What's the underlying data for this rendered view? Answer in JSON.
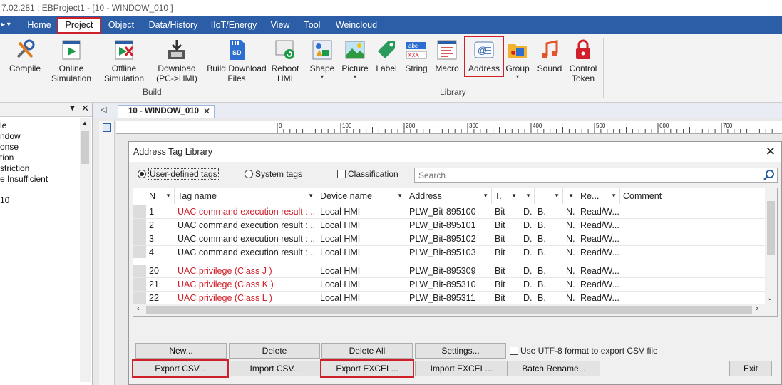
{
  "window_title": "7.02.281 : EBProject1 - [10 - WINDOW_010 ]",
  "quick_access_glyph": "▸ ▾",
  "menu": {
    "items": [
      "Home",
      "Project",
      "Object",
      "Data/History",
      "IIoT/Energy",
      "View",
      "Tool",
      "Weincloud"
    ],
    "active": "Project"
  },
  "ribbon": {
    "build_buttons": [
      {
        "label1": "Compile",
        "label2": "",
        "icon": "compile-icon"
      },
      {
        "label1": "Online",
        "label2": "Simulation",
        "icon": "online-simulation-icon"
      },
      {
        "label1": "Offline",
        "label2": "Simulation",
        "icon": "offline-simulation-icon"
      },
      {
        "label1": "Download",
        "label2": "(PC->HMI)",
        "icon": "download-icon"
      },
      {
        "label1": "Build Download",
        "label2": "Files",
        "icon": "sd-card-icon"
      },
      {
        "label1": "Reboot",
        "label2": "HMI",
        "icon": "reboot-icon"
      }
    ],
    "build_group_label": "Build",
    "library_buttons": [
      {
        "label1": "Shape",
        "label2": "▾",
        "icon": "shape-icon"
      },
      {
        "label1": "Picture",
        "label2": "▾",
        "icon": "picture-icon"
      },
      {
        "label1": "Label",
        "label2": "",
        "icon": "label-icon"
      },
      {
        "label1": "String",
        "label2": "",
        "icon": "string-icon"
      },
      {
        "label1": "Macro",
        "label2": "",
        "icon": "macro-icon"
      },
      {
        "label1": "Address",
        "label2": "",
        "icon": "address-icon"
      },
      {
        "label1": "Group",
        "label2": "▾",
        "icon": "group-icon"
      },
      {
        "label1": "Sound",
        "label2": "",
        "icon": "sound-icon"
      },
      {
        "label1": "Control",
        "label2": "Token",
        "icon": "lock-icon"
      }
    ],
    "library_group_label": "Library"
  },
  "left_tree": {
    "items": [
      "le",
      "ndow",
      "onse",
      "tion",
      "striction",
      "e Insufficient",
      "10"
    ]
  },
  "tab": {
    "label": "10 - WINDOW_010"
  },
  "ruler_labels": [
    "0",
    "100",
    "200",
    "300",
    "400",
    "500",
    "600",
    "700"
  ],
  "dialog": {
    "title": "Address Tag Library",
    "radio_user": "User-defined tags",
    "radio_system": "System tags",
    "classification": "Classification",
    "search_placeholder": "Search",
    "columns": [
      "N",
      "Tag name",
      "Device name",
      "Address",
      "T.",
      "",
      "",
      "",
      "Re...",
      "Comment"
    ],
    "rows": [
      {
        "n": "1",
        "tag": "UAC command execution result : ...",
        "device": "Local HMI",
        "address": "PLW_Bit-895100",
        "t": "Bit",
        "c6": "D.",
        "c7": "B.",
        "c8": "N.",
        "re": "Read/W...",
        "red": true
      },
      {
        "n": "2",
        "tag": "UAC command execution result : ...",
        "device": "Local HMI",
        "address": "PLW_Bit-895101",
        "t": "Bit",
        "c6": "D.",
        "c7": "B.",
        "c8": "N.",
        "re": "Read/W...",
        "red": false
      },
      {
        "n": "3",
        "tag": "UAC command execution result : ...",
        "device": "Local HMI",
        "address": "PLW_Bit-895102",
        "t": "Bit",
        "c6": "D.",
        "c7": "B.",
        "c8": "N.",
        "re": "Read/W...",
        "red": false
      },
      {
        "n": "4",
        "tag": "UAC command execution result : ...",
        "device": "Local HMI",
        "address": "PLW_Bit-895103",
        "t": "Bit",
        "c6": "D.",
        "c7": "B.",
        "c8": "N.",
        "re": "Read/W...",
        "red": false
      },
      {
        "n": "20",
        "tag": "UAC privilege (Class J )",
        "device": "Local HMI",
        "address": "PLW_Bit-895309",
        "t": "Bit",
        "c6": "D.",
        "c7": "B.",
        "c8": "N.",
        "re": "Read/W...",
        "red": true
      },
      {
        "n": "21",
        "tag": "UAC privilege (Class K )",
        "device": "Local HMI",
        "address": "PLW_Bit-895310",
        "t": "Bit",
        "c6": "D.",
        "c7": "B.",
        "c8": "N.",
        "re": "Read/W...",
        "red": true
      },
      {
        "n": "22",
        "tag": "UAC privilege (Class L )",
        "device": "Local HMI",
        "address": "PLW_Bit-895311",
        "t": "Bit",
        "c6": "D.",
        "c7": "B.",
        "c8": "N.",
        "re": "Read/W...",
        "red": true
      }
    ],
    "buttons_row1": [
      "New...",
      "Delete",
      "Delete All",
      "Settings..."
    ],
    "utf8_label": "Use UTF-8 format to export CSV file",
    "buttons_row2": [
      "Export CSV...",
      "Import CSV...",
      "Export EXCEL...",
      "Import EXCEL...",
      "Batch Rename..."
    ],
    "exit": "Exit"
  },
  "colors": {
    "accent": "#2c5ea8",
    "highlight": "#d0202a",
    "red_text": "#d0202a"
  }
}
